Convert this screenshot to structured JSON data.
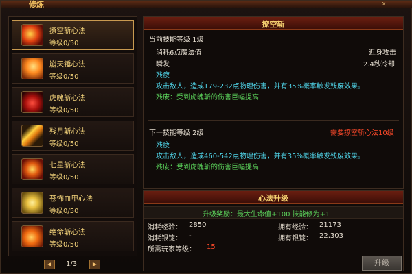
{
  "window": {
    "title": "修炼",
    "close_glyph": "x"
  },
  "skills": [
    {
      "name": "撩空斩心法",
      "level": "等级0/50",
      "icon": "flame-slash-icon"
    },
    {
      "name": "崩天锤心法",
      "level": "等级0/50",
      "icon": "fire-hammer-icon"
    },
    {
      "name": "虎魄斩心法",
      "level": "等级0/50",
      "icon": "tiger-slash-icon"
    },
    {
      "name": "残月斩心法",
      "level": "等级0/50",
      "icon": "crescent-slash-icon"
    },
    {
      "name": "七星斩心法",
      "level": "等级0/50",
      "icon": "seven-star-icon"
    },
    {
      "name": "苍怖血甲心法",
      "level": "等级0/50",
      "icon": "blood-armor-icon"
    },
    {
      "name": "绝命斩心法",
      "level": "等级0/50",
      "icon": "fatal-slash-icon"
    }
  ],
  "pager": {
    "text": "1/3",
    "prev": "◀",
    "next": "▶"
  },
  "detail": {
    "title": "撩空斩",
    "current": {
      "heading": "当前技能等级 1级",
      "cost": "消耗6点魔法值",
      "range": "近身攻击",
      "cast": "瞬发",
      "cooldown": "2.4秒冷却",
      "effect_name": "残疲",
      "desc": "攻击敌人，造成179-232点物理伤害，并有35%概率触发残废效果。",
      "bonus": "残废：受到虎魄斩的伤害巨幅提高"
    },
    "next": {
      "heading": "下一技能等级 2级",
      "requirement": "需要撩空斩心法10级",
      "effect_name": "残疲",
      "desc": "攻击敌人，造成460-542点物理伤害，并有35%概率触发残废效果。",
      "bonus": "残废：受到虎魄斩的伤害巨幅提高"
    }
  },
  "upgrade": {
    "title": "心法升级",
    "reward": "升级奖励：最大生命值+100  技能修为+1",
    "cost_exp_label": "消耗经验：",
    "cost_exp": "2850",
    "have_exp_label": "拥有经验：",
    "have_exp": "21173",
    "cost_silver_label": "消耗银锭：",
    "cost_silver": "-",
    "have_silver_label": "拥有银锭：",
    "have_silver": "22,303",
    "req_level_label": "所需玩家等级：",
    "req_level": "15",
    "button": "升级"
  },
  "colors": {
    "accent": "#f2d27a",
    "cyan": "#4fd2e6",
    "green": "#5bd35b",
    "red": "#ff4a2a"
  }
}
